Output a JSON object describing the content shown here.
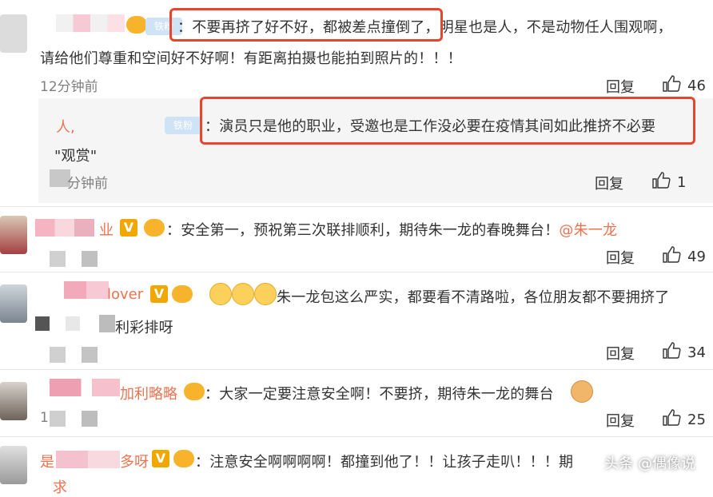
{
  "comments": [
    {
      "text_line1": "：不要再挤了好不好，都被差点撞倒了，明星也是人，不是动物任人围观啊，",
      "text_line2": "请给他们尊重和空间好不好啊！有距离拍摄也能拍到照片的！！！",
      "badge": "铁粉",
      "time": "12分钟前",
      "reply": "回复",
      "likes": "46"
    },
    {
      "name": "人,",
      "badge": "铁粉",
      "text_line1": "：演员只是他的职业，受邀也是工作没必要在疫情其间如此推挤不必要",
      "text_line2": "\"观赏\"",
      "time": "分钟前",
      "reply": "回复",
      "likes": "1"
    },
    {
      "name": "业",
      "text_line1": "：安全第一，预祝第三次联排顺利，期待朱一龙的春晚舞台！",
      "mention": "@朱一龙",
      "reply": "回复",
      "likes": "49"
    },
    {
      "name": "lover",
      "text_line1": "朱一龙包这么严实，都要看不清路啦，各位朋友都不要拥挤了",
      "text_line2": "利彩排呀",
      "reply": "回复",
      "likes": "34"
    },
    {
      "name": "加利略略",
      "text_line1": "：大家一定要注意安全啊！不要挤，期待朱一龙的舞台",
      "time": "1",
      "reply": "回复",
      "likes": "25"
    },
    {
      "name": "是",
      "name2": "多呀",
      "text_line1": "：注意安全啊啊啊啊！都撞到他了！！让孩子走叭！！！期",
      "text_line2": "求"
    }
  ],
  "watermark": "头条 @偶像说",
  "icons": [
    "thumbs-up-icon",
    "v-badge-icon",
    "level-badge-icon",
    "emoji-icon"
  ],
  "colors": {
    "name": "#eb7350",
    "highlight": "#e8462c",
    "meta": "#808080"
  }
}
